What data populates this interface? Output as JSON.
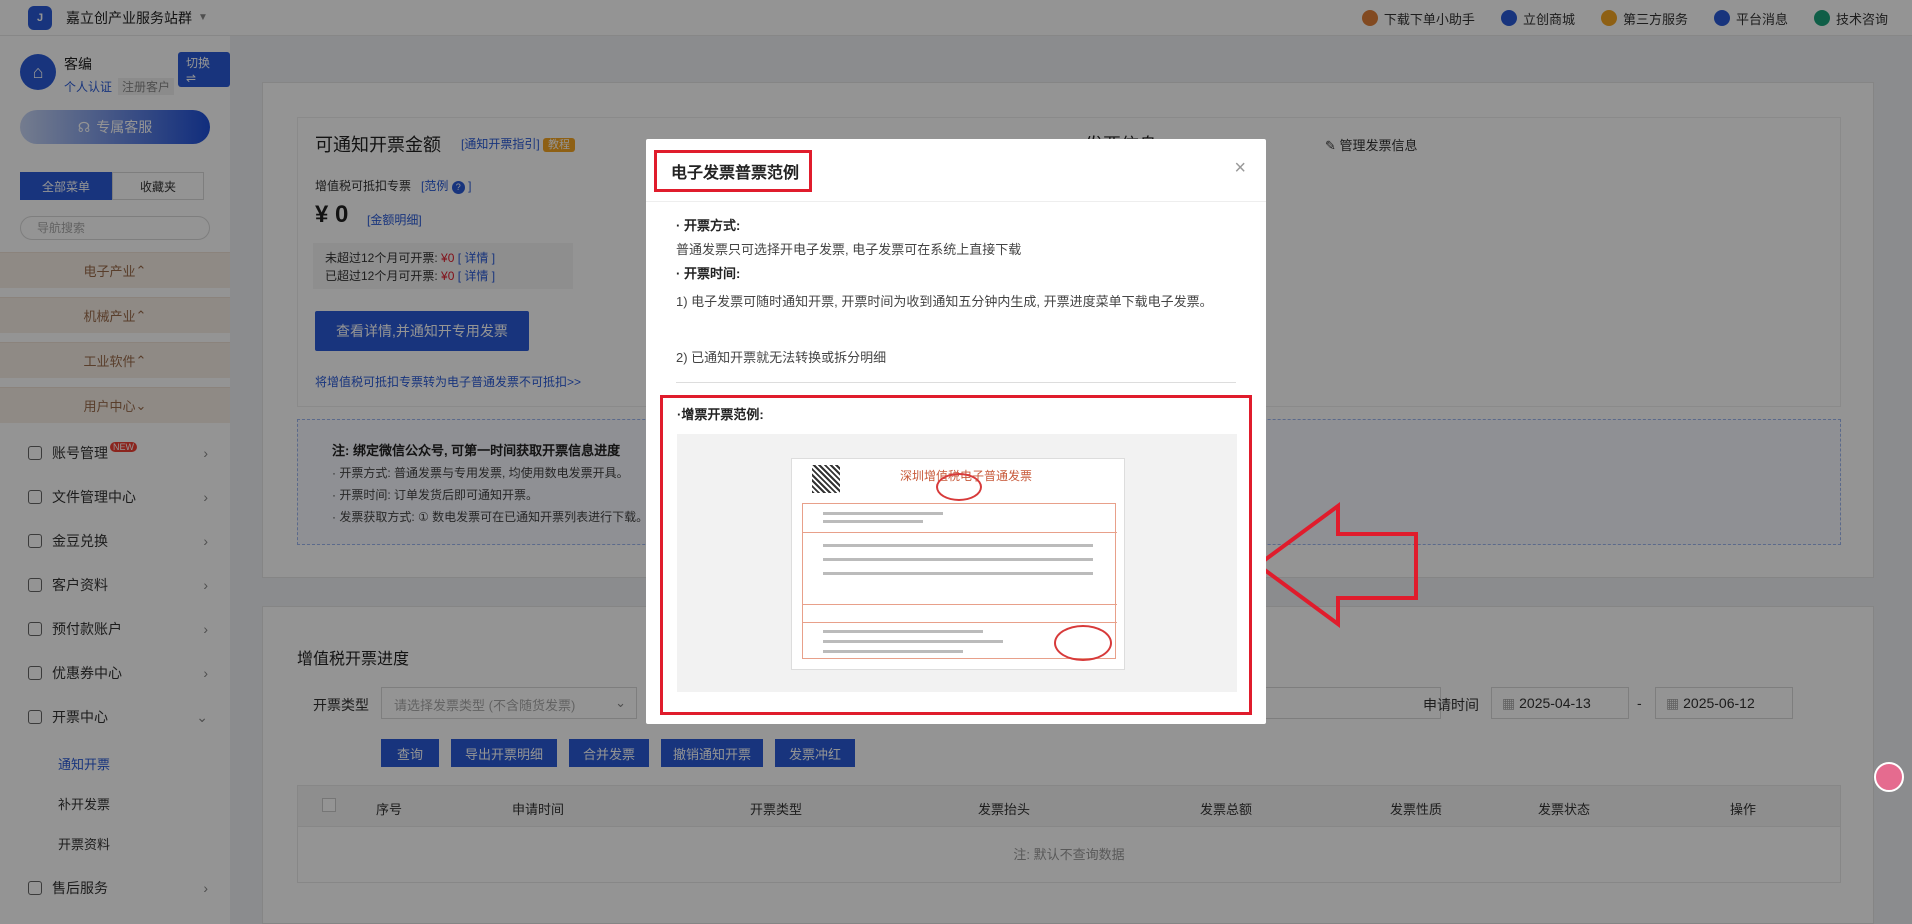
{
  "topbar": {
    "brand": "嘉立创产业服务站群",
    "links": [
      {
        "label": "下载下单小助手",
        "icon": "assistant-icon",
        "color": "#e0803a"
      },
      {
        "label": "立创商城",
        "icon": "mall-icon",
        "color": "#2a5bd7"
      },
      {
        "label": "第三方服务",
        "icon": "third-party-icon",
        "color": "#f5a623"
      },
      {
        "label": "平台消息",
        "icon": "bell-icon",
        "color": "#2a5bd7"
      },
      {
        "label": "技术咨询",
        "icon": "chat-icon",
        "color": "#1aa37a"
      }
    ]
  },
  "sidebar": {
    "user_name": "客编",
    "tag_verify": "个人认证",
    "tag_type": "注册客户",
    "switch_label": "切换 ⇌",
    "service_label": "专属客服",
    "tab_all": "全部菜单",
    "tab_fav": "收藏夹",
    "search_placeholder": "导航搜索",
    "industries": [
      "电子产业",
      "机械产业",
      "工业软件",
      "用户中心"
    ],
    "items": [
      "账号管理",
      "文件管理中心",
      "金豆兑换",
      "客户资料",
      "预付款账户",
      "优惠券中心",
      "开票中心",
      "售后服务"
    ],
    "new_badge": "NEW",
    "sub_items": [
      "通知开票",
      "补开发票",
      "开票资料"
    ]
  },
  "main": {
    "title": "可通知开票金额",
    "guide_link": "[通知开票指引]",
    "tutorial_tag": "教程",
    "invoice_info_title": "发票信息",
    "manage_link": "管理发票信息",
    "vat_label": "增值税可抵扣专票",
    "sample_link": "[范例",
    "sample_close": "]",
    "amount": "¥ 0",
    "amount_detail_link": "[金额明细]",
    "within_12": "未超过12个月可开票:",
    "over_12": "已超过12个月可开票:",
    "zero": "¥0",
    "detail_link": "[ 详情 ]",
    "action_button": "查看详情,并通知开专用发票",
    "convert_link": "将增值税可抵扣专票转为电子普通发票不可抵扣>>",
    "notice_title": "注: 绑定微信公众号, 可第一时间获取开票信息进度",
    "notice_lines": [
      "· 开票方式: 普通发票与专用发票, 均使用数电发票开具。",
      "· 开票时间: 订单发货后即可通知开票。",
      "· 发票获取方式: ① 数电发票可在已通知开票列表进行下载。"
    ],
    "progress_title": "增值税开票进度",
    "type_label": "开票类型",
    "type_placeholder": "请选择发票类型 (不含随货发票)",
    "apply_time_label": "申请时间",
    "date_from": "2025-04-13",
    "date_sep": "-",
    "date_to": "2025-06-12",
    "buttons": [
      "查询",
      "导出开票明细",
      "合并发票",
      "撤销通知开票",
      "发票冲红"
    ],
    "table_headers": [
      "序号",
      "申请时间",
      "开票类型",
      "发票抬头",
      "发票总额",
      "发票性质",
      "发票状态",
      "操作"
    ],
    "empty_text": "注: 默认不查询数据"
  },
  "modal": {
    "title": "电子发票普票范例",
    "close": "×",
    "section1_title": "· 开票方式:",
    "section1_text": "普通发票只可选择开电子发票, 电子发票可在系统上直接下载",
    "section2_title": "· 开票时间:",
    "section2_text1": "1) 电子发票可随时通知开票, 开票时间为收到通知五分钟内生成, 开票进度菜单下载电子发票。",
    "section2_text2": "2) 已通知开票就无法转换或拆分明细",
    "example_label": "·增票开票范例:",
    "invoice_title": "深圳增值税电子普通发票"
  },
  "colors": {
    "primary": "#2a5bd7",
    "highlight": "#e01c2c",
    "industry_bg": "#f7eee6"
  }
}
